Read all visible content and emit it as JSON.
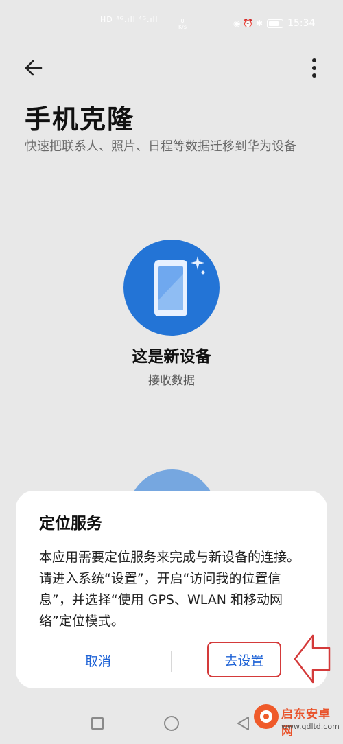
{
  "status_bar": {
    "network": "HD ⁴ᴳ.ıll ⁴ᴳ.ıll",
    "speed_value": "0",
    "speed_unit": "K/s",
    "icons": "◉ ⏰ ✱",
    "battery_label": "",
    "time": "15:34"
  },
  "header": {
    "title": "手机克隆",
    "subtitle": "快速把联系人、照片、日程等数据迁移到华为设备"
  },
  "new_device": {
    "title": "这是新设备",
    "subtitle": "接收数据"
  },
  "dialog": {
    "title": "定位服务",
    "body": "本应用需要定位服务来完成与新设备的连接。请进入系统“设置”，开启“访问我的位置信息”，并选择“使用 GPS、WLAN 和移动网络”定位模式。",
    "cancel_label": "取消",
    "confirm_label": "去设置"
  },
  "watermark": {
    "name": "启东安卓网",
    "url": "www.qdltd.com"
  },
  "colors": {
    "accent": "#2374d6",
    "link": "#1f63d6",
    "annotation": "#d43a3a"
  },
  "icons": {
    "back": "arrow-left-icon",
    "more": "more-vertical-icon",
    "device": "phone-sparkle-icon"
  }
}
